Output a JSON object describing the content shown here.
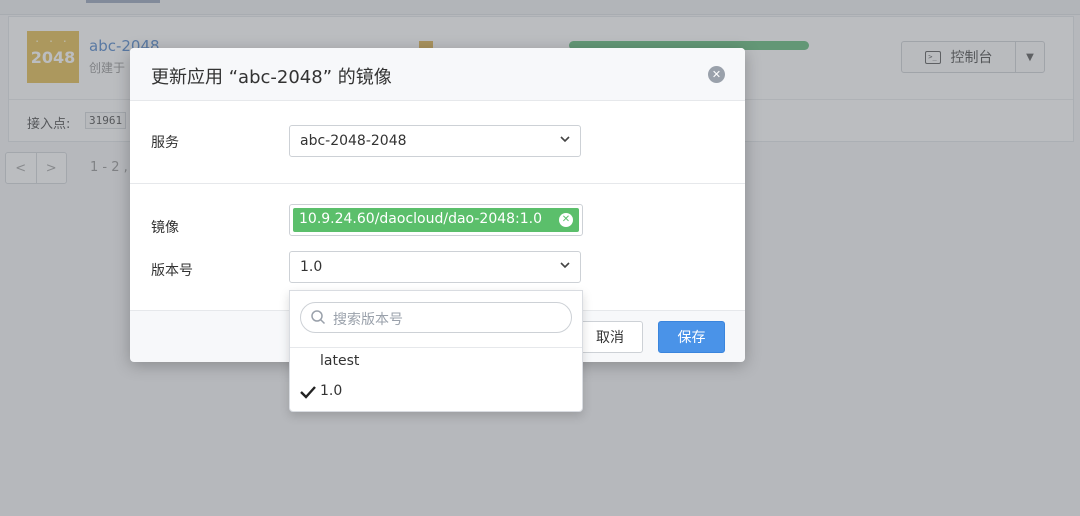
{
  "background": {
    "app_logo_text": "2048",
    "app_name": "abc-2048",
    "created_text": "创建于",
    "console_label": "控制台",
    "endpoint_label": "接入点:",
    "endpoint_value": "31961",
    "pager_prev": "<",
    "pager_next": ">",
    "pager_range": "1 - 2 ,"
  },
  "modal": {
    "title": "更新应用 “abc-2048” 的镜像",
    "close_icon": "close-icon",
    "service": {
      "label": "服务",
      "selected": "abc-2048-2048"
    },
    "image": {
      "label": "镜像",
      "value": "10.9.24.60/daocloud/dao-2048:1.0"
    },
    "version": {
      "label": "版本号",
      "selected": "1.0"
    },
    "footer": {
      "cancel_label": "取消",
      "save_label": "保存"
    }
  },
  "version_dropdown": {
    "search_placeholder": "搜索版本号",
    "options": [
      {
        "label": "latest",
        "selected": false
      },
      {
        "label": "1.0",
        "selected": true
      }
    ]
  },
  "colors": {
    "tag_green": "#5bbf6b",
    "primary_blue": "#4a93e8",
    "link_blue": "#3a76c4",
    "logo_gold": "#e1b43a"
  }
}
